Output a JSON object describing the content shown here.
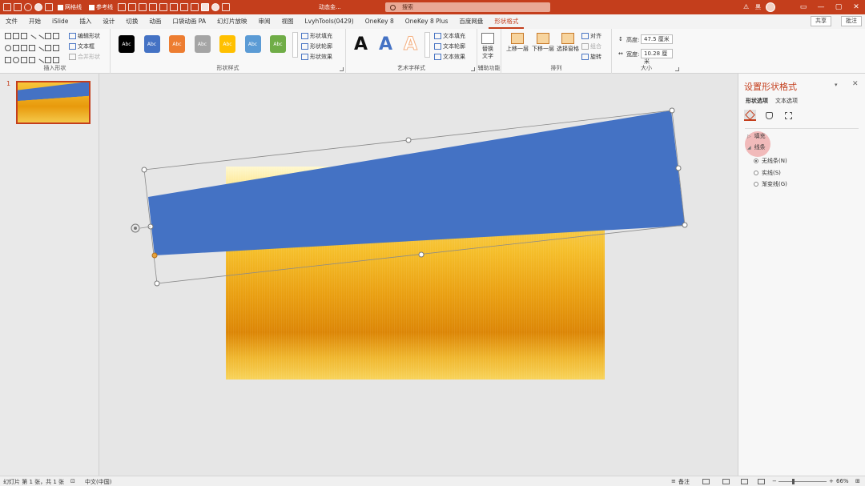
{
  "titlebar": {
    "quick_access": {
      "gridlines": "网格线",
      "guides": "参考线"
    },
    "document_name": "动态金...",
    "search_placeholder": "搜索",
    "warning": "⚠",
    "user": "黑",
    "win_controls": [
      "▭",
      "—",
      "▢",
      "✕"
    ]
  },
  "tabs": [
    "文件",
    "开始",
    "iSlide",
    "插入",
    "设计",
    "切换",
    "动画",
    "口袋动画 PA",
    "幻灯片放映",
    "审阅",
    "视图",
    "LvyhTools(0429)",
    "OneKey 8",
    "OneKey 8 Plus",
    "百度网盘",
    "形状格式"
  ],
  "active_tab_index": 15,
  "share": "共享",
  "comment": "批注",
  "ribbon": {
    "insert_shapes": {
      "label": "插入形状",
      "edit_shape": "编辑形状",
      "text_box": "文本框",
      "merge_shapes": "合并形状"
    },
    "shape_styles": {
      "label": "形状样式",
      "sample": "Abc",
      "colors": [
        "#000000",
        "#4472c4",
        "#ed7d31",
        "#a5a5a5",
        "#ffc000",
        "#5b9bd5",
        "#70ad47"
      ],
      "fill": "形状填充",
      "outline": "形状轮廓",
      "effects": "形状效果"
    },
    "wordart": {
      "label": "艺术字样式",
      "glyph": "A",
      "glyph_colors": [
        "#111111",
        "#4472c4",
        "#f4b183"
      ],
      "text_fill": "文本填充",
      "text_outline": "文本轮廓",
      "text_effects": "文本效果"
    },
    "accessibility": {
      "label": "辅助功能",
      "alt_text_1": "替换",
      "alt_text_2": "文字"
    },
    "arrange": {
      "label": "排列",
      "bring_forward": "上移一层",
      "send_backward": "下移一层",
      "selection_pane": "选择窗格",
      "align": "对齐",
      "group": "组合",
      "rotate": "旋转"
    },
    "size": {
      "label": "大小",
      "height_label": "高度:",
      "height_value": "47.5 厘米",
      "width_label": "宽度:",
      "width_value": "10.28 厘米"
    }
  },
  "thumbnail": {
    "slide_number": "1"
  },
  "format_pane": {
    "title": "设置形状格式",
    "menu": "▾",
    "close": "✕",
    "subtabs": [
      "形状选项",
      "文本选项"
    ],
    "fill_section": "填充",
    "line_section": "线条",
    "line_options": [
      "无线条(N)",
      "实线(S)",
      "渐变线(G)"
    ],
    "selected_option_index": 0
  },
  "status": {
    "slide_info": "幻灯片 第 1 张，共 1 张",
    "language": "中文(中国)",
    "notes": "备注",
    "zoom": "66%"
  },
  "colors": {
    "accent": "#c43e1c",
    "shape_blue": "#4472c4"
  }
}
